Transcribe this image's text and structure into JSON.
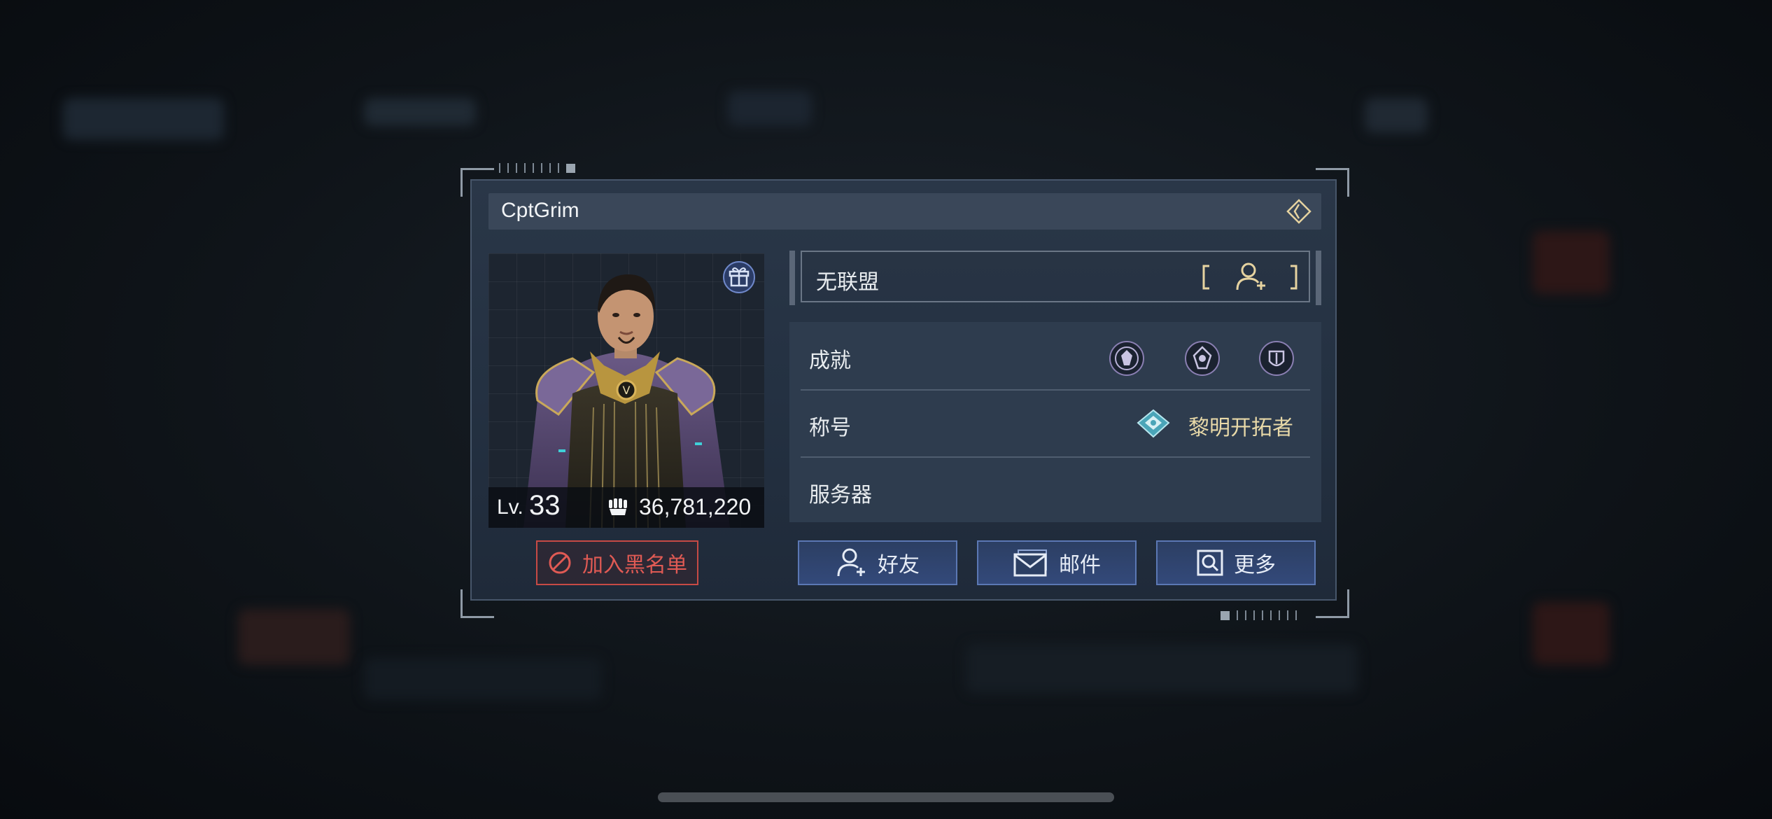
{
  "player": {
    "name": "CptGrim",
    "level_prefix": "Lv.",
    "level": "33",
    "power": "36,781,220"
  },
  "alliance": {
    "status": "无联盟"
  },
  "info": {
    "achievements_label": "成就",
    "title_label": "称号",
    "title_value": "黎明开拓者",
    "server_label": "服务器",
    "server_value": ""
  },
  "actions": {
    "blacklist_label": "加入黑名单",
    "friend_label": "好友",
    "mail_label": "邮件",
    "more_label": "更多"
  },
  "colors": {
    "accent_gold": "#e8d9a8",
    "danger": "#e05a54",
    "button_blue": "#33497a"
  },
  "icons": {
    "top_right": "diamond-toggle-icon",
    "gift": "gift-icon",
    "power": "fist-icon",
    "add_alliance": "add-user-icon",
    "achievement_badges": [
      "achievement-badge-icon",
      "achievement-badge-icon",
      "achievement-badge-icon"
    ],
    "title": "title-emblem-icon"
  }
}
